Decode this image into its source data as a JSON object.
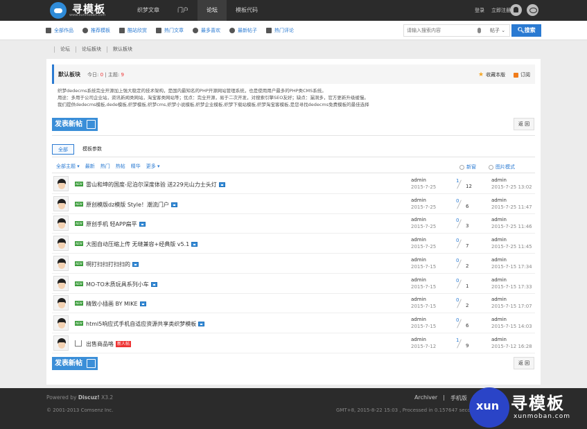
{
  "site": {
    "title": "寻模板",
    "subtitle": "www.xunmoban.com"
  },
  "topnav": [
    "织梦文章",
    "门户",
    "论坛",
    "模板代码"
  ],
  "toplinks": {
    "login": "登录",
    "register": "立即注册"
  },
  "subnav": [
    {
      "label": "全部作品",
      "icon": "grid-icon"
    },
    {
      "label": "推荐模板",
      "icon": "bulb-icon"
    },
    {
      "label": "酷站欣赏",
      "icon": "image-icon"
    },
    {
      "label": "热门文章",
      "icon": "document-icon"
    },
    {
      "label": "最多喜欢",
      "icon": "heart-icon"
    },
    {
      "label": "最新帖子",
      "icon": "clock-icon"
    },
    {
      "label": "热门评论",
      "icon": "comment-icon"
    }
  ],
  "search": {
    "placeholder": "请输入搜索内容",
    "type": "帖子",
    "button": "搜索"
  },
  "breadcrumb": [
    "论坛",
    "论坛板块",
    "默认板块"
  ],
  "forum": {
    "name": "默认板块",
    "today_label": "今日:",
    "today": "0",
    "threads_label": "主题:",
    "threads": "9",
    "favorite": "收藏本版",
    "subscribe": "订阅",
    "desc": [
      "织梦dedecms系统完全开源加上强大稳定的技术架构，是国内最知名的PHP开源网站管理系统，也是使用用户最多的PHP类CMS系统。",
      "用途：多用于公司企业站，资讯新闻类网站，淘宝客类网站等；优点：完全开源，易于二次开发，对搜索引擎SEO友好；缺点：漏洞多，官方更新升级缓慢。",
      "我们提供dedecms模板,dede模板,织梦模板,织梦cms,织梦小说模板,织梦企业模板,织梦下载站模板,织梦淘宝客模板,是您寻找dedecms免费模板的最佳选择"
    ]
  },
  "post_button": "发表新帖",
  "back_button": "返 回",
  "tabs": [
    "全部",
    "模板参数"
  ],
  "filters": [
    "全部主题 ▾",
    "最新",
    "热门",
    "热帖",
    "精华",
    "更多 ▾"
  ],
  "checks": {
    "new": "新窗",
    "pic": "图片模式"
  },
  "threads": [
    {
      "title": "雷山和坤的国度-尼泊尔深度体验 送229元山力士头灯",
      "author": "admin",
      "date": "2015-7-25",
      "replies": "1",
      "views": "12",
      "last_user": "admin",
      "last_time": "2015-7-25 13:02",
      "tag": "new",
      "badge": ""
    },
    {
      "title": "原创模版dz模版 Style！潮流门户",
      "author": "admin",
      "date": "2015-7-25",
      "replies": "0",
      "views": "6",
      "last_user": "admin",
      "last_time": "2015-7-25 11:47",
      "tag": "new",
      "badge": ""
    },
    {
      "title": "原创手机 轻APP扁平",
      "author": "admin",
      "date": "2015-7-25",
      "replies": "0",
      "views": "3",
      "last_user": "admin",
      "last_time": "2015-7-25 11:46",
      "tag": "new",
      "badge": ""
    },
    {
      "title": "大图自动压缩上传 无缝兼容+经典版 v5.1",
      "author": "admin",
      "date": "2015-7-25",
      "replies": "0",
      "views": "7",
      "last_user": "admin",
      "last_time": "2015-7-25 11:45",
      "tag": "new",
      "badge": ""
    },
    {
      "title": "啊打扫扫打扫扫的",
      "author": "admin",
      "date": "2015-7-15",
      "replies": "0",
      "views": "2",
      "last_user": "admin",
      "last_time": "2015-7-15 17:34",
      "tag": "new",
      "badge": ""
    },
    {
      "title": "MO-TO木质玩具系列小车",
      "author": "admin",
      "date": "2015-7-15",
      "replies": "0",
      "views": "1",
      "last_user": "admin",
      "last_time": "2015-7-15 17:33",
      "tag": "new",
      "badge": ""
    },
    {
      "title": "精致小插画 BY MIKE",
      "author": "admin",
      "date": "2015-7-15",
      "replies": "0",
      "views": "2",
      "last_user": "admin",
      "last_time": "2015-7-15 17:07",
      "tag": "new",
      "badge": ""
    },
    {
      "title": "html5响应式手机自适应资源共享类织梦模板",
      "author": "admin",
      "date": "2015-7-15",
      "replies": "0",
      "views": "6",
      "last_user": "admin",
      "last_time": "2015-7-15 14:03",
      "tag": "new",
      "badge": ""
    },
    {
      "title": "出售商品咯",
      "author": "admin",
      "date": "2015-7-12",
      "replies": "1",
      "views": "9",
      "last_user": "admin",
      "last_time": "2015-7-12 16:28",
      "tag": "trade",
      "badge": "新人帖"
    }
  ],
  "footer": {
    "powered": "Powered by",
    "brand": "Discuz!",
    "version": "X3.2",
    "copyright": "© 2001-2013 Comsenz Inc.",
    "links": [
      "Archiver",
      "手机版"
    ],
    "info": "GMT+8, 2015-8-22 15:03 , Processed in 0.157647 second"
  },
  "watermark": {
    "circle": "xun",
    "title": "寻模板",
    "url": "xunmoban.com"
  }
}
